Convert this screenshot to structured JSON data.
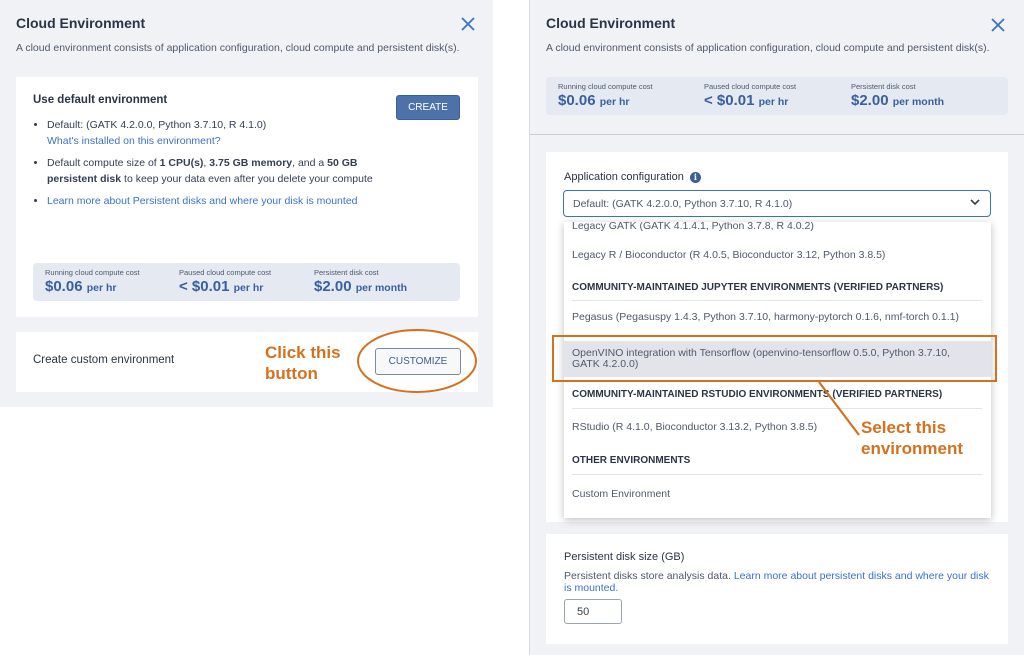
{
  "left": {
    "title": "Cloud Environment",
    "description": "A cloud environment consists of application configuration, cloud compute and persistent disk(s).",
    "default_section": {
      "heading": "Use default environment",
      "create_label": "CREATE",
      "bullet1": "Default: (GATK 4.2.0.0, Python 3.7.10, R 4.1.0)",
      "bullet1_link": "What's installed on this environment?",
      "bullet2_a": "Default compute size of ",
      "bullet2_b": "1 CPU(s)",
      "bullet2_c": ", ",
      "bullet2_d": "3.75 GB memory",
      "bullet2_e": ", and a ",
      "bullet2_f": "50 GB persistent disk",
      "bullet2_g": " to keep your data even after you delete your compute",
      "bullet3_link": "Learn more about Persistent disks and where your disk is mounted"
    },
    "costs": [
      {
        "label": "Running cloud compute cost",
        "value": "$0.06",
        "unit": "per hr"
      },
      {
        "label": "Paused cloud compute cost",
        "value": "< $0.01",
        "unit": "per hr"
      },
      {
        "label": "Persistent disk cost",
        "value": "$2.00",
        "unit": "per month"
      }
    ],
    "custom_section": {
      "heading": "Create custom environment",
      "customize_label": "CUSTOMIZE"
    },
    "annotation": "Click this button"
  },
  "right": {
    "title": "Cloud Environment",
    "description": "A cloud environment consists of application configuration, cloud compute and persistent disk(s).",
    "costs": [
      {
        "label": "Running cloud compute cost",
        "value": "$0.06",
        "unit": "per hr"
      },
      {
        "label": "Paused cloud compute cost",
        "value": "< $0.01",
        "unit": "per hr"
      },
      {
        "label": "Persistent disk cost",
        "value": "$2.00",
        "unit": "per month"
      }
    ],
    "app_config_label": "Application configuration",
    "select_value": "Default: (GATK 4.2.0.0, Python 3.7.10, R 4.1.0)",
    "options": {
      "legacy_gatk": "Legacy GATK (GATK 4.1.4.1, Python 3.7.8, R 4.0.2)",
      "legacy_r": "Legacy R / Bioconductor (R 4.0.5, Bioconductor 3.12, Python 3.8.5)",
      "group_jupyter": "COMMUNITY-MAINTAINED JUPYTER ENVIRONMENTS (VERIFIED PARTNERS)",
      "pegasus": "Pegasus (Pegasuspy 1.4.3, Python 3.7.10, harmony-pytorch 0.1.6, nmf-torch 0.1.1)",
      "openvino": "OpenVINO integration with Tensorflow (openvino-tensorflow 0.5.0, Python 3.7.10, GATK 4.2.0.0)",
      "group_rstudio": "COMMUNITY-MAINTAINED RSTUDIO ENVIRONMENTS (VERIFIED PARTNERS)",
      "rstudio": "RStudio (R 4.1.0, Bioconductor 3.13.2, Python 3.8.5)",
      "group_other": "OTHER ENVIRONMENTS",
      "custom": "Custom Environment"
    },
    "annotation": "Select this environment",
    "disk": {
      "label": "Persistent disk size (GB)",
      "help_a": "Persistent disks store analysis data. ",
      "help_link": "Learn more about persistent disks and where your disk is mounted.",
      "value": "50"
    }
  },
  "colors": {
    "accent": "#3a72c6",
    "annotation": "#d4711f",
    "cost_value": "#3a5f9e"
  },
  "icons": [
    "close-icon",
    "info-icon",
    "chevron-down-icon"
  ]
}
